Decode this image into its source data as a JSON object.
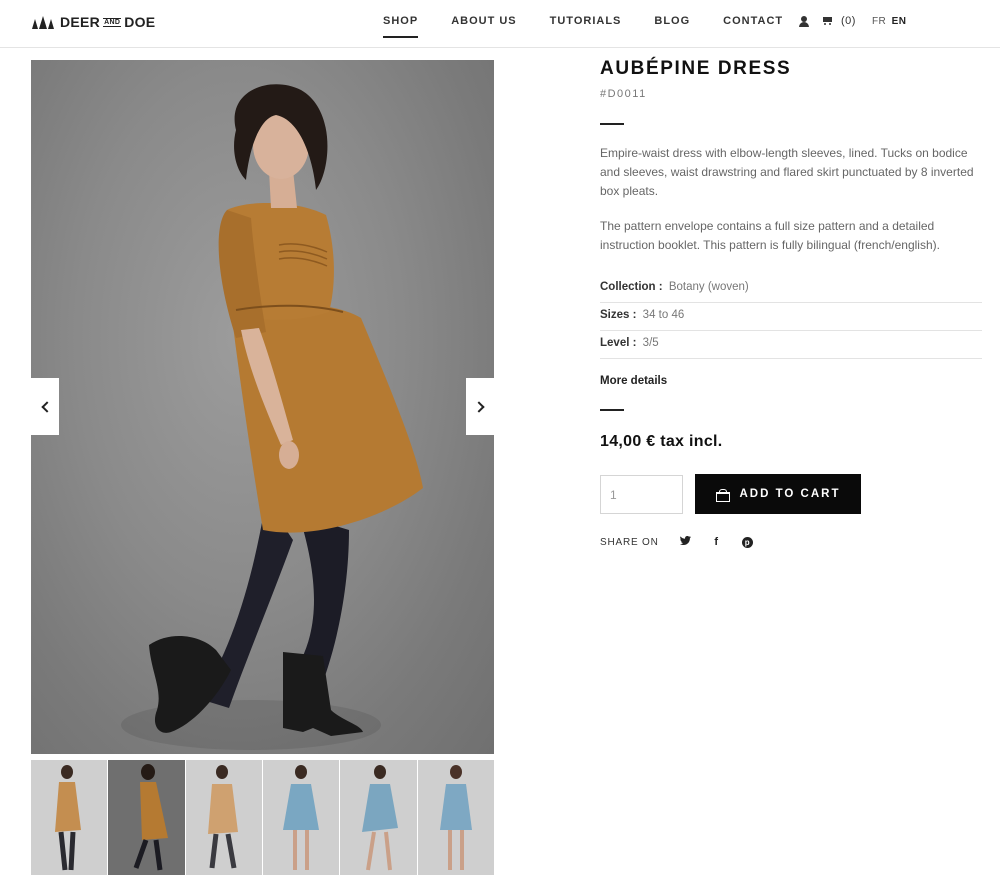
{
  "brand": {
    "name_left": "DEER",
    "name_and": "AND",
    "name_right": "DOE"
  },
  "nav": {
    "items": [
      {
        "label": "SHOP",
        "active": true
      },
      {
        "label": "ABOUT US",
        "active": false
      },
      {
        "label": "TUTORIALS",
        "active": false
      },
      {
        "label": "BLOG",
        "active": false
      },
      {
        "label": "CONTACT",
        "active": false
      }
    ]
  },
  "header_tools": {
    "user_icon": "user-icon",
    "cart_icon": "cart-icon",
    "cart_count": "(0)",
    "lang_fr": "FR",
    "lang_en": "EN"
  },
  "gallery": {
    "prev_icon": "chevron-left-icon",
    "next_icon": "chevron-right-icon",
    "thumbnail_count": 6,
    "active_thumbnail": 2
  },
  "product": {
    "title": "AUBÉPINE DRESS",
    "reference": "#D0011",
    "description_1": "Empire-waist dress with elbow-length sleeves, lined. Tucks on bodice and sleeves, waist drawstring and flared skirt punctuated by 8 inverted box pleats.",
    "description_2": "The pattern envelope contains a full size pattern and a detailed instruction booklet. This pattern is fully bilingual (french/english).",
    "specs": [
      {
        "key": "Collection",
        "sep": ":",
        "value": "Botany (woven)"
      },
      {
        "key": "Sizes",
        "sep": ":",
        "value": "34 to 46"
      },
      {
        "key": "Level",
        "sep": ":",
        "value": "3/5"
      }
    ],
    "more_details": "More details",
    "price": "14,00 € tax incl.",
    "quantity": "1",
    "add_to_cart": "ADD TO CART",
    "add_to_cart_icon": "basket-icon"
  },
  "share": {
    "label": "SHARE ON",
    "icons": [
      "twitter-icon",
      "facebook-icon",
      "pinterest-icon"
    ],
    "twitter_glyph": "🐦",
    "facebook_glyph": "f",
    "pinterest_glyph": "p"
  },
  "colors": {
    "accent_dark": "#0a0a0a",
    "dress": "#b57a32",
    "background_grey": "#8a8a8a",
    "text_muted": "#666666"
  }
}
